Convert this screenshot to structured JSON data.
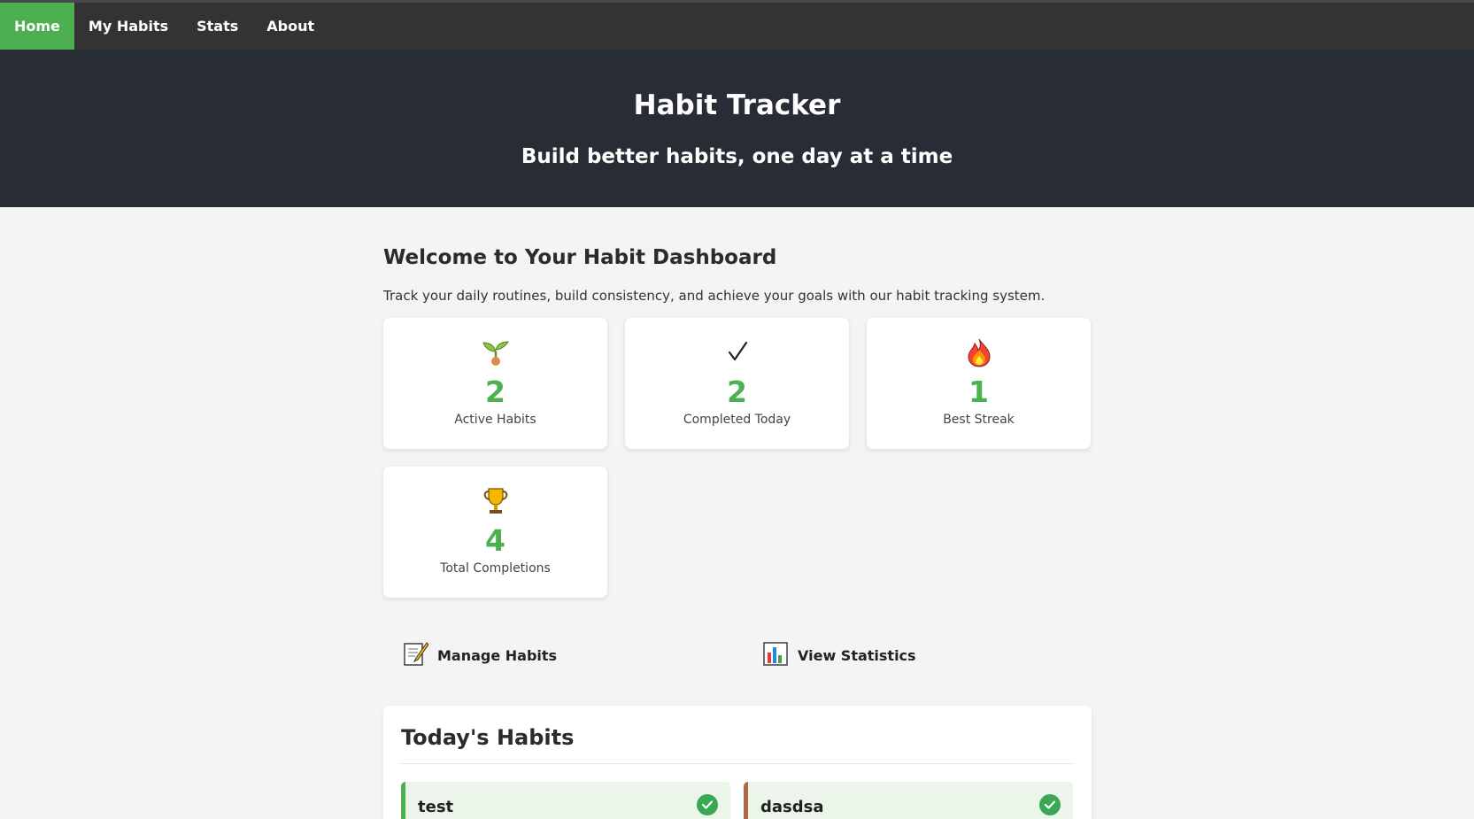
{
  "nav": {
    "items": [
      {
        "label": "Home",
        "active": true
      },
      {
        "label": "My Habits"
      },
      {
        "label": "Stats"
      },
      {
        "label": "About"
      }
    ]
  },
  "hero": {
    "title": "Habit Tracker",
    "subtitle": "Build better habits, one day at a time"
  },
  "welcome": {
    "title": "Welcome to Your Habit Dashboard",
    "text": "Track your daily routines, build consistency, and achieve your goals with our habit tracking system."
  },
  "stats": [
    {
      "icon": "seedling-icon",
      "value": "2",
      "label": "Active Habits"
    },
    {
      "icon": "checkmark-icon",
      "value": "2",
      "label": "Completed Today"
    },
    {
      "icon": "fire-icon",
      "value": "1",
      "label": "Best Streak"
    },
    {
      "icon": "trophy-icon",
      "value": "4",
      "label": "Total Completions"
    }
  ],
  "actions": {
    "manage": {
      "label": "Manage Habits",
      "icon": "memo-icon"
    },
    "stats": {
      "label": "View Statistics",
      "icon": "bar-chart-icon"
    }
  },
  "today": {
    "title": "Today's Habits",
    "habits": [
      {
        "name": "test",
        "completed": true,
        "color": "#4caf50"
      },
      {
        "name": "dasdsa",
        "completed": true,
        "color": "#b0684a"
      }
    ]
  },
  "colors": {
    "accent": "#4caf50",
    "nav_bg": "#333333",
    "hero_bg": "#282c34"
  }
}
